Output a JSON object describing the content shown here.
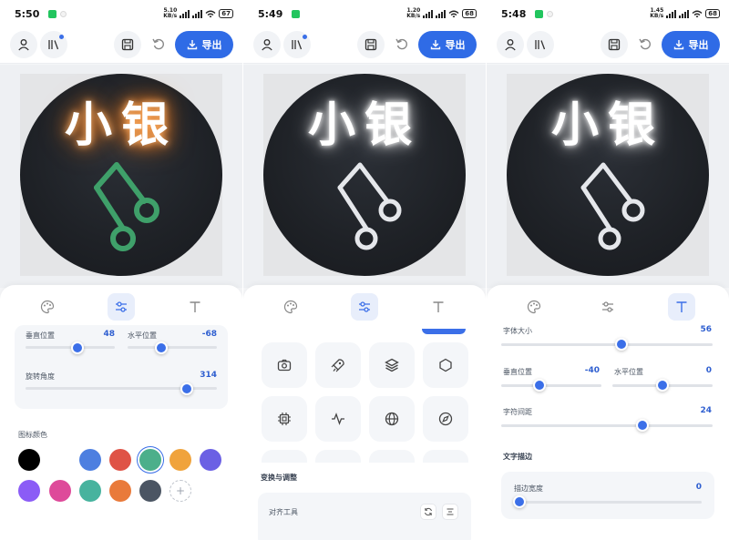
{
  "screens": [
    {
      "status": {
        "time": "5:50",
        "speed_top": "5.10",
        "speed_unit": "KB/s",
        "battery": "67"
      },
      "logo_text": "小银",
      "logo_color": "#3fa06a",
      "glow_color": "#ff8a2a",
      "sliders": [
        {
          "label": "垂直位置",
          "value": "48"
        },
        {
          "label": "水平位置",
          "value": "-68"
        },
        {
          "label": "旋转角度",
          "value": "314"
        }
      ],
      "color_section": "图标颜色",
      "colors": [
        "#000000",
        "#ffffff",
        "#4d7fe0",
        "#df5346",
        "#4caf8b",
        "#f0a33c",
        "#6b60e4",
        "#8b5cf6",
        "#de4a9a",
        "#47b39e",
        "#e97a3a",
        "#4b5563"
      ],
      "add_color_icon": "+"
    },
    {
      "status": {
        "time": "5:49",
        "speed_top": "1.20",
        "speed_unit": "KB/s",
        "battery": "68"
      },
      "logo_text": "小银",
      "logo_color": "#e5e7eb",
      "icons": [
        "camera-icon",
        "rocket-icon",
        "layers-icon",
        "hexagon-icon",
        "chip-icon",
        "activity-icon",
        "globe-icon",
        "compass-icon"
      ],
      "section_title": "变换与调整",
      "align_tools": "对齐工具"
    },
    {
      "status": {
        "time": "5:48",
        "speed_top": "1.45",
        "speed_unit": "KB/s",
        "battery": "68"
      },
      "logo_text": "小银",
      "logo_color": "#e5e7eb",
      "sliders": [
        {
          "label": "字体大小",
          "value": "56"
        },
        {
          "label": "垂直位置",
          "value": "-40"
        },
        {
          "label": "水平位置",
          "value": "0"
        },
        {
          "label": "字符间距",
          "value": "24"
        }
      ],
      "stroke_section": "文字描边",
      "stroke_width": {
        "label": "描边宽度",
        "value": "0"
      }
    }
  ],
  "toolbar": {
    "export_label": "导出"
  },
  "accent": "#2f6be6"
}
